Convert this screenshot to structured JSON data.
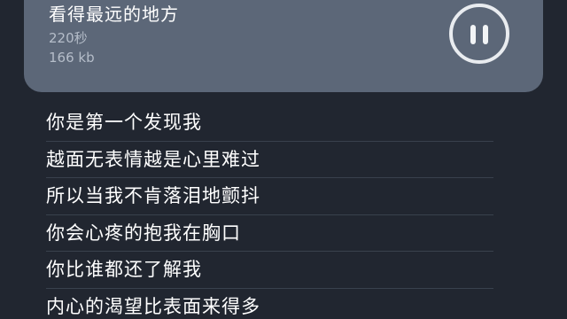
{
  "player": {
    "title": "看得最远的地方",
    "duration": "220秒",
    "size": "166 kb",
    "pause_icon": "pause-icon"
  },
  "lyrics": [
    "你是第一个发现我",
    "越面无表情越是心里难过",
    "所以当我不肯落泪地颤抖",
    "你会心疼的抱我在胸口",
    "你比谁都还了解我",
    "内心的渴望比表面来得多"
  ],
  "colors": {
    "background": "#212630",
    "card": "#5c6778",
    "text": "#ffffff",
    "muted": "#b5bdc9"
  }
}
